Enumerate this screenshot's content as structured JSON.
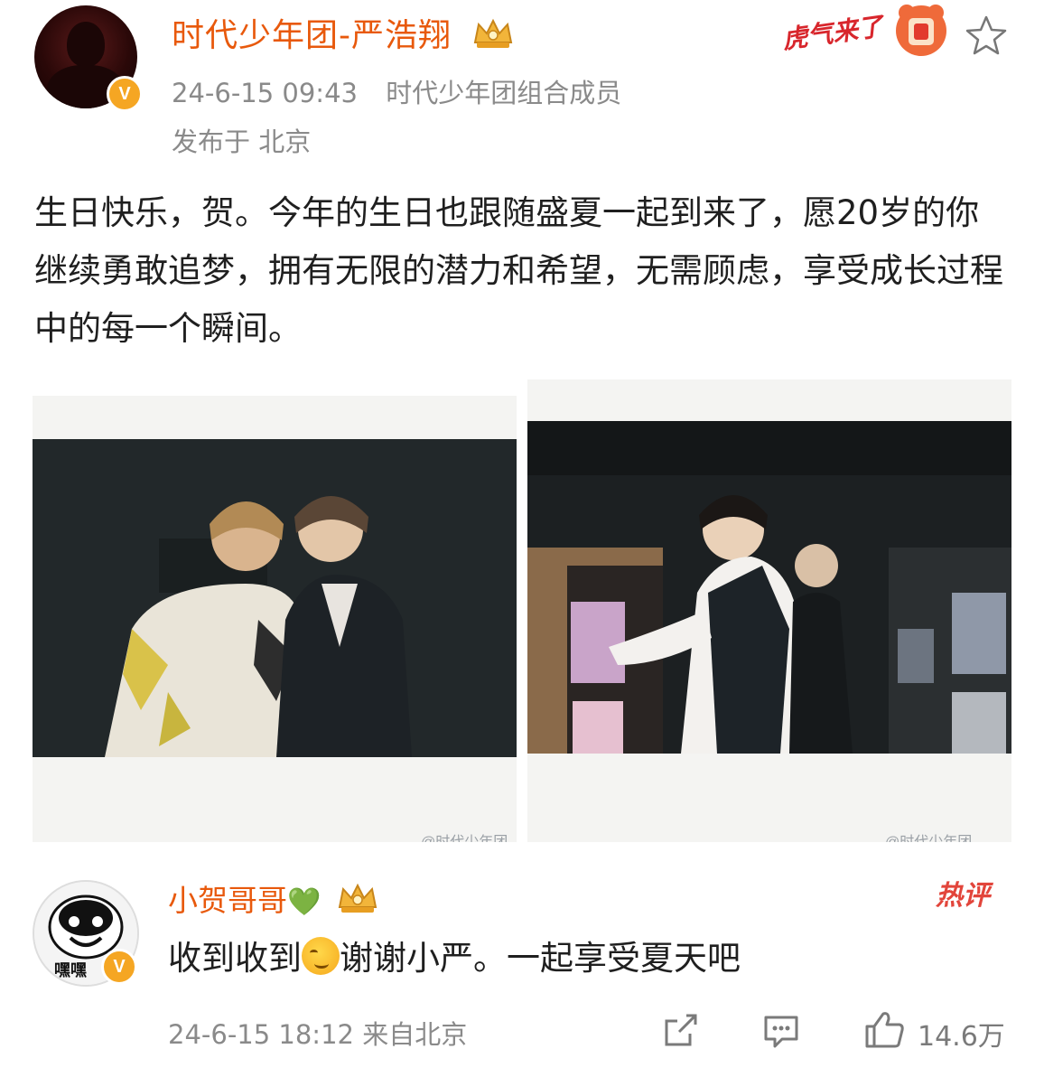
{
  "post": {
    "username": "时代少年团-严浩翔",
    "timestamp": "24-6-15 09:43",
    "source": "时代少年团组合成员",
    "location": "发布于 北京",
    "banner_text": "虎气来了",
    "text": "生日快乐，贺。今年的生日也跟随盛夏一起到来了，愿20岁的你继续勇敢追梦，拥有无限的潜力和希望，无需顾虑，享受成长过程中的每一个瞬间。",
    "photo1_watermark": "@时代少年团",
    "photo2_watermark": "@时代少年团"
  },
  "comment": {
    "username": "小贺哥哥",
    "heart": "💚",
    "hot_label": "热评",
    "text_before": "收到收到",
    "text_after": "谢谢小严。一起享受夏天吧",
    "avatar_caption": "嘿嘿",
    "time_source": "24-6-15 18:12 来自北京",
    "likes": "14.6万"
  },
  "icons": {
    "verified": "V",
    "crown": "crown-icon",
    "star": "star-icon",
    "share": "share-icon",
    "comment": "comment-icon",
    "like": "like-icon"
  },
  "colors": {
    "name": "#e8590c",
    "meta": "#8a8a8a",
    "verified": "#f5a623",
    "hot": "#e2453b"
  }
}
